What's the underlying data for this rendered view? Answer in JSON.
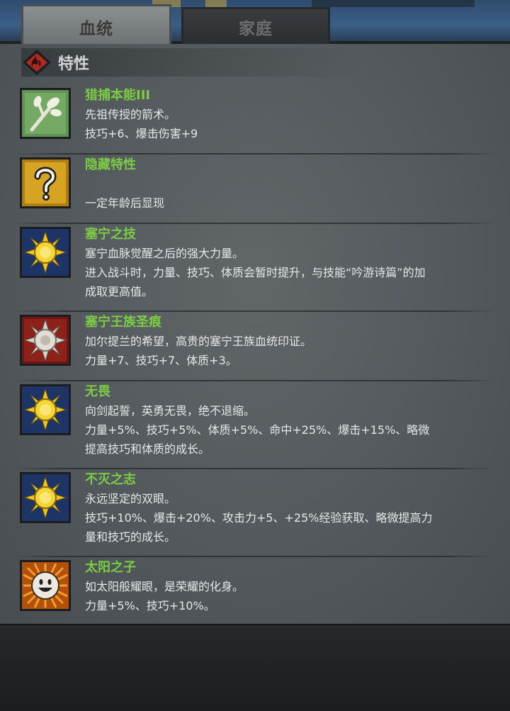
{
  "tabs": [
    {
      "label": "血统",
      "active": true
    },
    {
      "label": "家庭",
      "active": false
    }
  ],
  "section": {
    "title": "特性",
    "icon": "fire-emblem-icon"
  },
  "traits": [
    {
      "name": "猎捕本能III",
      "icon": "branch-icon",
      "lines": [
        "先祖传授的箭术。",
        "技巧+6、爆击伤害+9"
      ]
    },
    {
      "name": "隐藏特性",
      "icon": "question-mark-icon",
      "lines": [
        "",
        "一定年龄后显现"
      ]
    },
    {
      "name": "塞宁之技",
      "icon": "sun-emblem-icon",
      "lines": [
        "塞宁血脉觉醒之后的强大力量。",
        "进入战斗时，力量、技巧、体质会暂时提升，与技能“吟游诗篇”的加",
        "成取更高值。"
      ]
    },
    {
      "name": "塞宁王族圣痕",
      "icon": "silver-sun-emblem-icon",
      "lines": [
        "加尔提兰的希望，高贵的塞宁王族血统印证。",
        "力量+7、技巧+7、体质+3。"
      ]
    },
    {
      "name": "无畏",
      "icon": "sun-emblem-icon",
      "lines": [
        "向剑起誓，英勇无畏，绝不退缩。",
        "力量+5%、技巧+5%、体质+5%、命中+25%、爆击+15%、略微",
        "提高技巧和体质的成长。"
      ]
    },
    {
      "name": "不灭之志",
      "icon": "sun-emblem-icon",
      "lines": [
        "永远坚定的双眼。",
        "技巧+10%、爆击+20%、攻击力+5、+25%经验获取、略微提高力",
        "量和技巧的成长。"
      ]
    },
    {
      "name": "太阳之子",
      "icon": "smiling-sun-icon",
      "lines": [
        "如太阳般耀眼，是荣耀的化身。",
        "力量+5%、技巧+10%。"
      ]
    }
  ],
  "colors": {
    "trait_name": "#7ccb45",
    "trait_text": "#e6e8e8",
    "panel": "#585e61",
    "active_tab": "#7b8083",
    "inactive_tab": "#323537"
  }
}
